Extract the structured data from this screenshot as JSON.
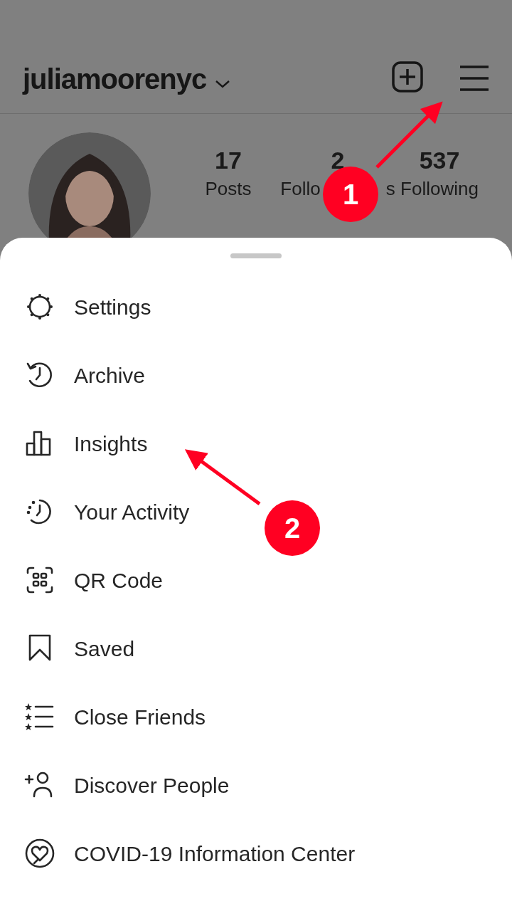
{
  "header": {
    "username": "juliamoorenyc"
  },
  "stats": [
    {
      "number": "17",
      "label": "Posts"
    },
    {
      "number": "2",
      "label": "Follo",
      "label_end": "s"
    },
    {
      "number": "537",
      "label": "Following"
    }
  ],
  "menu": [
    {
      "label": "Settings"
    },
    {
      "label": "Archive"
    },
    {
      "label": "Insights"
    },
    {
      "label": "Your Activity"
    },
    {
      "label": "QR Code"
    },
    {
      "label": "Saved"
    },
    {
      "label": "Close Friends"
    },
    {
      "label": "Discover People"
    },
    {
      "label": "COVID-19 Information Center"
    }
  ],
  "callouts": [
    "1",
    "2"
  ]
}
